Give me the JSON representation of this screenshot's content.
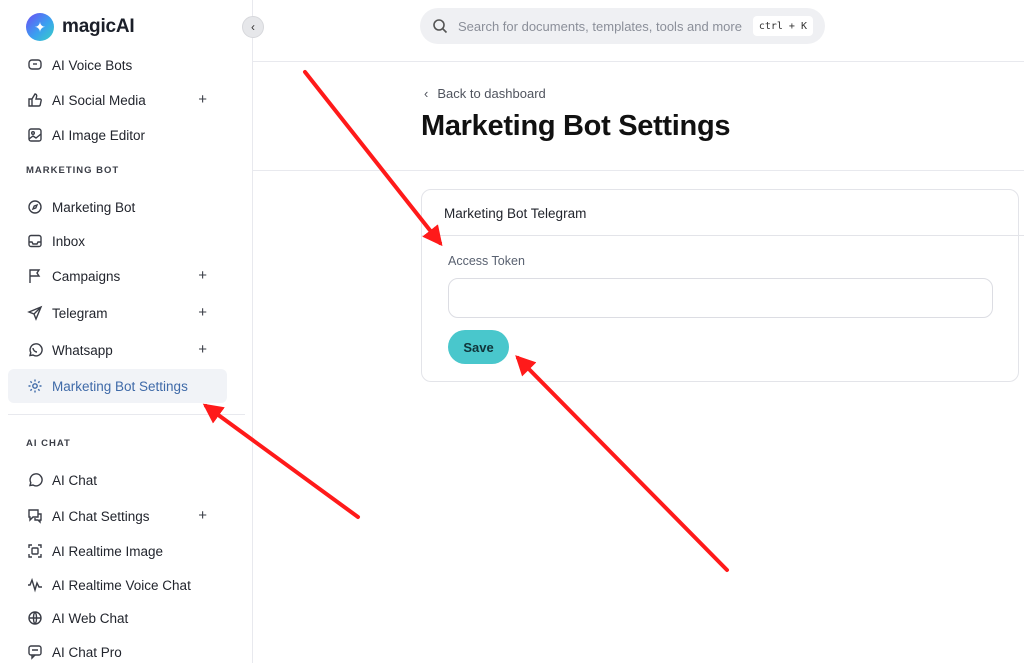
{
  "brand": {
    "name": "magicAI",
    "logo_icon": "sparkle-icon"
  },
  "sidebar": {
    "items": [
      {
        "label": "AI Voice Bots",
        "icon": "voice-bot-icon",
        "plus": false
      },
      {
        "label": "AI Social Media",
        "icon": "thumbs-up-icon",
        "plus": true
      },
      {
        "label": "AI Image Editor",
        "icon": "image-edit-icon",
        "plus": false
      },
      {
        "label": "Marketing Bot",
        "icon": "compass-icon",
        "plus": false
      },
      {
        "label": "Inbox",
        "icon": "inbox-icon",
        "plus": false
      },
      {
        "label": "Campaigns",
        "icon": "flag-icon",
        "plus": true
      },
      {
        "label": "Telegram",
        "icon": "send-icon",
        "plus": true
      },
      {
        "label": "Whatsapp",
        "icon": "whatsapp-icon",
        "plus": true
      },
      {
        "label": "Marketing Bot Settings",
        "icon": "gear-icon",
        "plus": false,
        "active": true
      },
      {
        "label": "AI Chat",
        "icon": "chat-bubble-icon",
        "plus": false
      },
      {
        "label": "AI Chat Settings",
        "icon": "chat-settings-icon",
        "plus": true
      },
      {
        "label": "AI Realtime Image",
        "icon": "realtime-image-icon",
        "plus": false
      },
      {
        "label": "AI Realtime Voice Chat",
        "icon": "waveform-icon",
        "plus": false
      },
      {
        "label": "AI Web Chat",
        "icon": "globe-icon",
        "plus": false
      },
      {
        "label": "AI Chat Pro",
        "icon": "chat-pro-icon",
        "plus": false
      }
    ],
    "sections": {
      "marketing_bot": "MARKETING BOT",
      "ai_chat": "AI CHAT"
    },
    "plus_symbol": "+"
  },
  "search": {
    "placeholder": "Search for documents, templates, tools and more",
    "shortcut": "ctrl + K"
  },
  "main": {
    "back_label": "Back to dashboard",
    "title": "Marketing Bot Settings",
    "card": {
      "title": "Marketing Bot Telegram",
      "field_label": "Access Token",
      "field_value": "",
      "save_label": "Save"
    }
  },
  "colors": {
    "accent": "#49c7cc",
    "active_text": "#3f6aa8",
    "annotation_arrow": "#ff1a1a"
  }
}
